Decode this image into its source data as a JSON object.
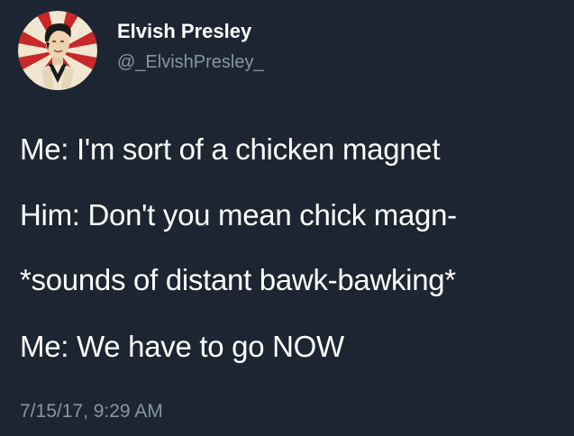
{
  "author": {
    "display_name": "Elvish Presley",
    "handle": "@_ElvishPresley_",
    "avatar_icon": "elvis-portrait-avatar-icon"
  },
  "tweet": {
    "lines": [
      "Me: I'm sort of a chicken magnet",
      "Him: Don't you mean chick magn-",
      "*sounds of distant bawk-bawking*",
      "Me: We have to go NOW"
    ],
    "timestamp": "7/15/17, 9:29 AM"
  },
  "colors": {
    "background": "#1c2531",
    "text": "#ffffff",
    "muted": "#8795a5",
    "avatar_red": "#c8282a",
    "avatar_cream": "#f1e6cf"
  }
}
